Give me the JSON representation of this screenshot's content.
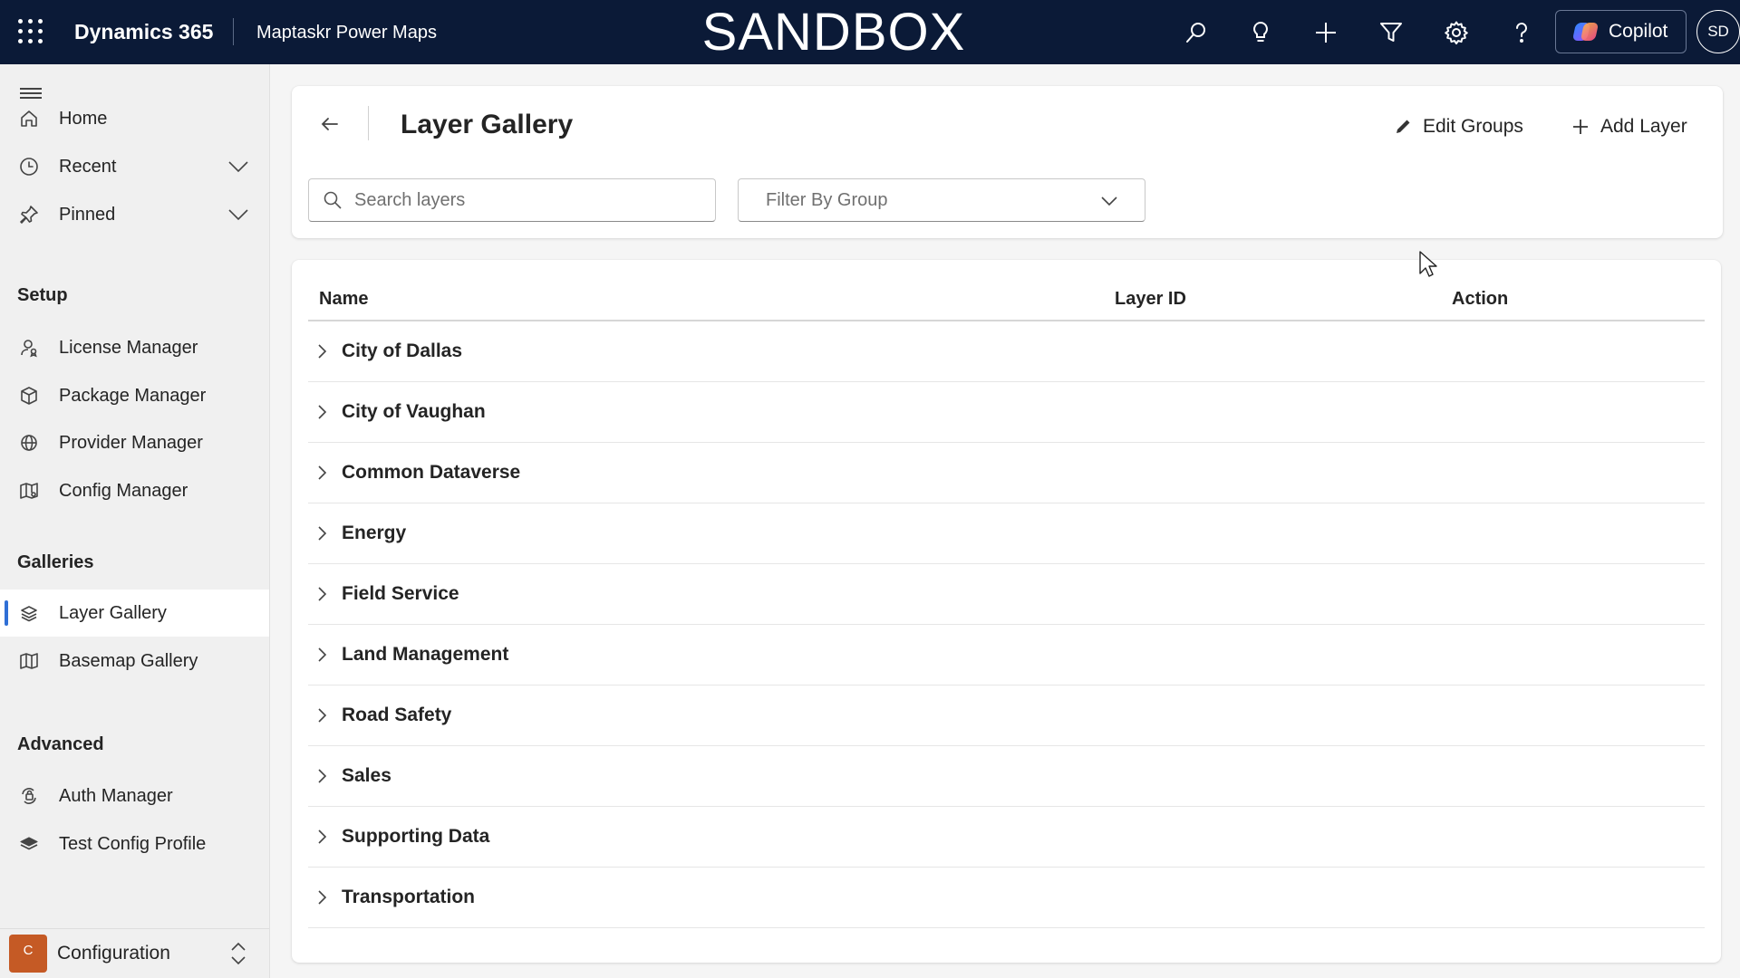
{
  "topbar": {
    "brand": "Dynamics 365",
    "app_name": "Maptaskr Power Maps",
    "environment": "SANDBOX",
    "icons": [
      "search-icon",
      "lightbulb-icon",
      "plus-icon",
      "filter-icon",
      "gear-icon",
      "help-icon"
    ],
    "copilot_label": "Copilot",
    "avatar_initials": "SD",
    "background_color": "#0b1a37"
  },
  "sidebar": {
    "items_top": [
      {
        "label": "Home",
        "icon": "home-icon"
      },
      {
        "label": "Recent",
        "icon": "clock-icon",
        "expandable": true
      },
      {
        "label": "Pinned",
        "icon": "pin-icon",
        "expandable": true
      }
    ],
    "sections": [
      {
        "title": "Setup",
        "items": [
          {
            "label": "License Manager",
            "icon": "license-icon"
          },
          {
            "label": "Package Manager",
            "icon": "package-icon"
          },
          {
            "label": "Provider Manager",
            "icon": "globe-icon"
          },
          {
            "label": "Config Manager",
            "icon": "map-config-icon"
          }
        ]
      },
      {
        "title": "Galleries",
        "items": [
          {
            "label": "Layer Gallery",
            "icon": "layers-icon",
            "active": true
          },
          {
            "label": "Basemap Gallery",
            "icon": "map-icon"
          }
        ]
      },
      {
        "title": "Advanced",
        "items": [
          {
            "label": "Auth Manager",
            "icon": "auth-icon"
          },
          {
            "label": "Test Config Profile",
            "icon": "stack-icon"
          }
        ]
      }
    ],
    "area": {
      "badge": "C",
      "label": "Configuration",
      "badge_color": "#c55a25"
    },
    "active_indicator_color": "#2f6fd6"
  },
  "header": {
    "title": "Layer Gallery",
    "edit_groups_label": "Edit Groups",
    "add_layer_label": "Add Layer",
    "search_placeholder": "Search layers",
    "search_value": "",
    "filter_placeholder": "Filter By Group"
  },
  "table": {
    "columns": [
      "Name",
      "Layer ID",
      "Action"
    ],
    "rows": [
      {
        "name": "City of Dallas"
      },
      {
        "name": "City of Vaughan"
      },
      {
        "name": "Common Dataverse"
      },
      {
        "name": "Energy"
      },
      {
        "name": "Field Service"
      },
      {
        "name": "Land Management"
      },
      {
        "name": "Road Safety"
      },
      {
        "name": "Sales"
      },
      {
        "name": "Supporting Data"
      },
      {
        "name": "Transportation"
      }
    ]
  }
}
